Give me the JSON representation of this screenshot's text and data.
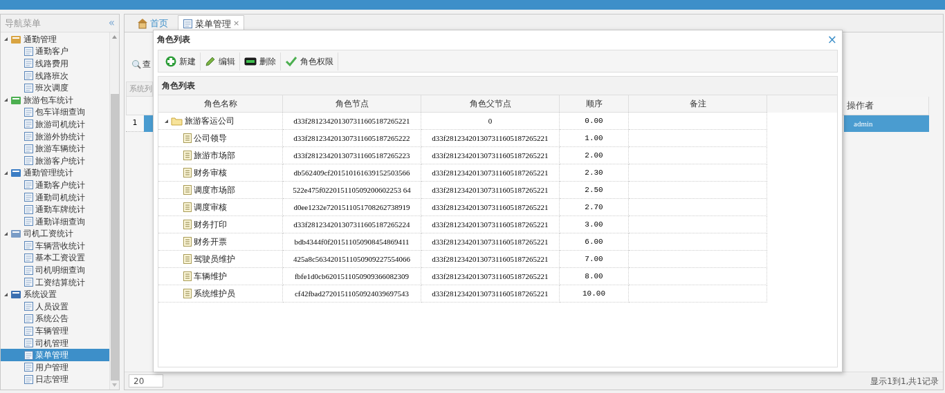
{
  "sidebar": {
    "title": "导航菜单",
    "collapse_glyph": "«",
    "groups": [
      {
        "label": "通勤管理",
        "expanded": true,
        "children": [
          {
            "label": "通勤客户",
            "selected": false
          },
          {
            "label": "线路费用",
            "selected": false
          },
          {
            "label": "线路班次",
            "selected": false
          },
          {
            "label": "班次调度",
            "selected": false
          }
        ]
      },
      {
        "label": "旅游包车统计",
        "expanded": true,
        "children": [
          {
            "label": "包车详细查询",
            "selected": false
          },
          {
            "label": "旅游司机统计",
            "selected": false
          },
          {
            "label": "旅游外协统计",
            "selected": false
          },
          {
            "label": "旅游车辆统计",
            "selected": false
          },
          {
            "label": "旅游客户统计",
            "selected": false
          }
        ]
      },
      {
        "label": "通勤管理统计",
        "expanded": true,
        "children": [
          {
            "label": "通勤客户统计",
            "selected": false
          },
          {
            "label": "通勤司机统计",
            "selected": false
          },
          {
            "label": "通勤车牌统计",
            "selected": false
          },
          {
            "label": "通勤详细查询",
            "selected": false
          }
        ]
      },
      {
        "label": "司机工资统计",
        "expanded": true,
        "children": [
          {
            "label": "车辆营收统计",
            "selected": false
          },
          {
            "label": "基本工资设置",
            "selected": false
          },
          {
            "label": "司机明细查询",
            "selected": false
          },
          {
            "label": "工资结算统计",
            "selected": false
          }
        ]
      },
      {
        "label": "系统设置",
        "expanded": true,
        "children": [
          {
            "label": "人员设置",
            "selected": false
          },
          {
            "label": "系统公告",
            "selected": false
          },
          {
            "label": "车辆管理",
            "selected": false
          },
          {
            "label": "司机管理",
            "selected": false
          },
          {
            "label": "菜单管理",
            "selected": true
          },
          {
            "label": "用户管理",
            "selected": false
          },
          {
            "label": "日志管理",
            "selected": false
          }
        ]
      }
    ]
  },
  "tabs": [
    {
      "label": "首页",
      "selected": false,
      "closable": false
    },
    {
      "label": "菜单管理",
      "selected": true,
      "closable": true,
      "close_glyph": "×"
    }
  ],
  "background_page": {
    "search_label": "查",
    "panel_title": "系统列",
    "row_number": "1",
    "operator_header": "操作者",
    "operator_cell": "admin",
    "pager": {
      "field_value": "20",
      "info": "显示1到1,共1记录"
    }
  },
  "dialog": {
    "title": "角色列表",
    "close_glyph": "×",
    "toolbar": [
      {
        "kind": "add",
        "label": "新建"
      },
      {
        "kind": "edit",
        "label": "编辑"
      },
      {
        "kind": "delete",
        "label": "删除"
      },
      {
        "kind": "check",
        "label": "角色权限"
      }
    ],
    "grid": {
      "title": "角色列表",
      "columns": [
        "角色名称",
        "角色节点",
        "角色父节点",
        "顺序",
        "备注"
      ],
      "rows": [
        {
          "kind": "folder",
          "expanded": true,
          "name": "旅游客运公司",
          "node": "d33f281234201307311605187265221",
          "parent": "0",
          "order": "0.00",
          "children": [
            {
              "kind": "file",
              "name": "公司领导",
              "node": "d33f281234201307311605187265222",
              "parent": "d33f281234201307311605187265221",
              "order": "1.00"
            },
            {
              "kind": "file",
              "name": "旅游市场部",
              "node": "d33f281234201307311605187265223",
              "parent": "d33f281234201307311605187265221",
              "order": "2.00"
            },
            {
              "kind": "file",
              "name": "财务审核",
              "node": "db562409cf201510161639152503566",
              "parent": "d33f281234201307311605187265221",
              "order": "2.30"
            },
            {
              "kind": "file",
              "name": "调度市场部",
              "node": "522e475f022015110509200602253 64",
              "parent": "d33f281234201307311605187265221",
              "order": "2.50"
            },
            {
              "kind": "file",
              "name": "调度审核",
              "node": "d0ee1232e7201511051708262738919",
              "parent": "d33f281234201307311605187265221",
              "order": "2.70"
            },
            {
              "kind": "file",
              "name": "财务打印",
              "node": "d33f281234201307311605187265224",
              "parent": "d33f281234201307311605187265221",
              "order": "3.00"
            },
            {
              "kind": "file",
              "name": "财务开票",
              "node": "bdb4344f0f201511050908454869411",
              "parent": "d33f281234201307311605187265221",
              "order": "6.00"
            },
            {
              "kind": "file",
              "name": "驾驶员维护",
              "node": "425a8c5634201511050909227554066",
              "parent": "d33f281234201307311605187265221",
              "order": "7.00"
            },
            {
              "kind": "file",
              "name": "车辆维护",
              "node": "fbfe1d0cb6201511050909366082309",
              "parent": "d33f281234201307311605187265221",
              "order": "8.00"
            },
            {
              "kind": "file",
              "name": "系统维护员",
              "node": "cf42fbad27201511050924039697543",
              "parent": "d33f281234201307311605187265221",
              "order": "10.00"
            }
          ]
        }
      ]
    }
  }
}
